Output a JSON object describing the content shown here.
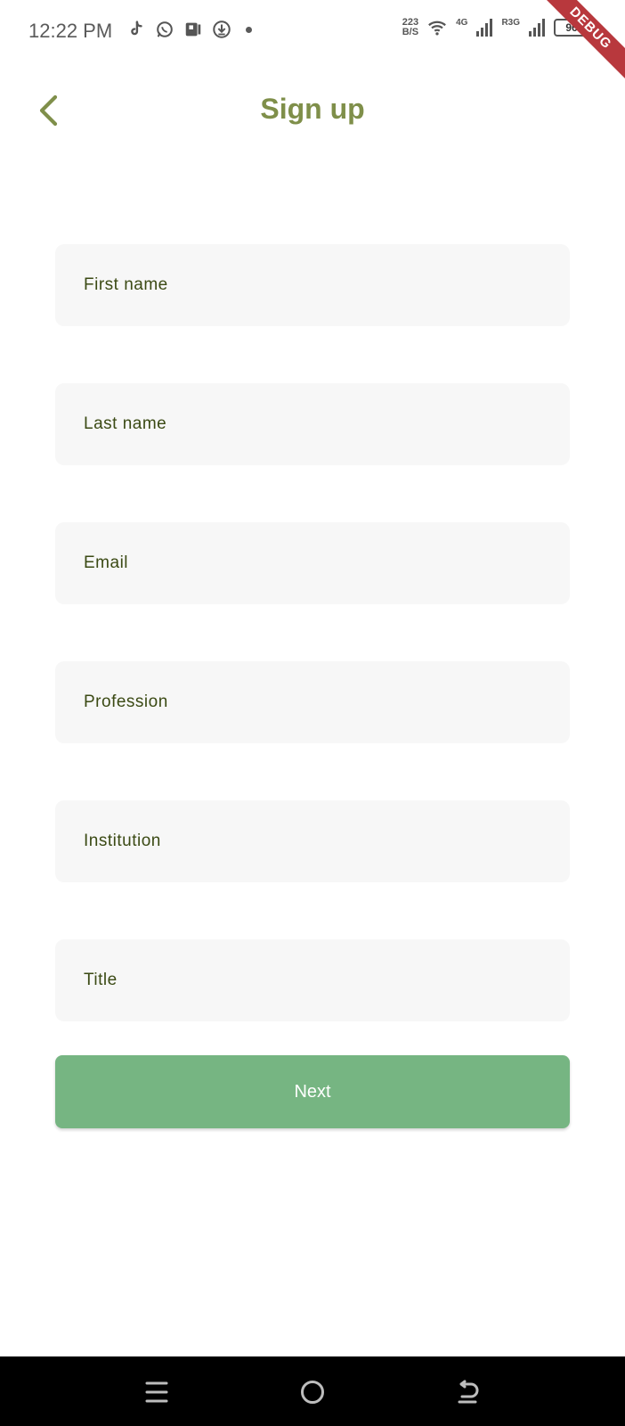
{
  "status_bar": {
    "time": "12:22 PM",
    "net_speed_value": "223",
    "net_speed_unit": "B/S",
    "network_1": "4G",
    "network_2": "R3G",
    "battery": "96",
    "icons": [
      "tiktok-icon",
      "whatsapp-icon",
      "parking-icon",
      "download-icon",
      "wifi-icon",
      "signal-icon",
      "charging-icon"
    ]
  },
  "debug_banner": "DEBUG",
  "app_bar": {
    "title": "Sign up",
    "back_icon": "chevron-left-icon"
  },
  "form": {
    "fields": [
      {
        "label": "First name"
      },
      {
        "label": "Last name"
      },
      {
        "label": "Email"
      },
      {
        "label": "Profession"
      },
      {
        "label": "Institution"
      },
      {
        "label": "Title"
      }
    ],
    "next_label": "Next"
  },
  "nav_bar": {
    "icons": [
      "menu-icon",
      "home-icon",
      "back-icon"
    ]
  },
  "colors": {
    "accent": "#7f8f4a",
    "button": "#76b582",
    "field_bg": "#f7f7f7",
    "field_text": "#3b4a14",
    "debug": "#b8383d"
  }
}
